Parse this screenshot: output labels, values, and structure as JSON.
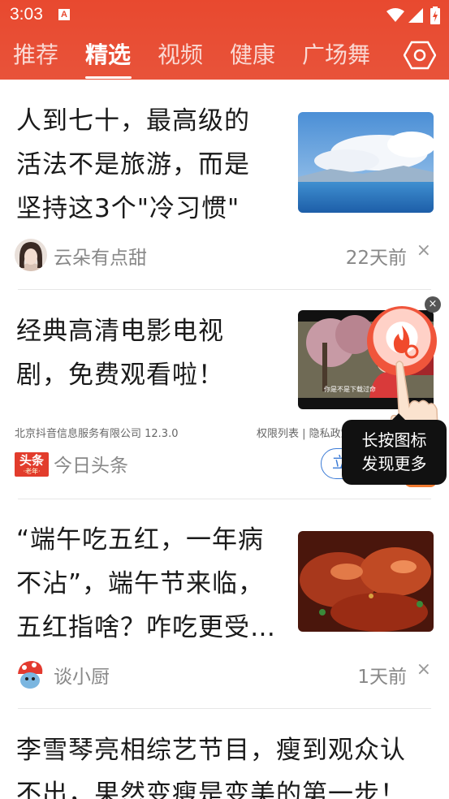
{
  "status_bar": {
    "time": "3:03",
    "notification_letter": "A"
  },
  "tabs": [
    {
      "label": "推荐",
      "active": false
    },
    {
      "label": "精选",
      "active": true
    },
    {
      "label": "视频",
      "active": false
    },
    {
      "label": "健康",
      "active": false
    },
    {
      "label": "广场舞",
      "active": false
    }
  ],
  "feed": [
    {
      "title_lines": [
        "人到七十，最高级的",
        "活法不是旅游，而是",
        "坚持这3个\"冷习惯\""
      ],
      "author": "云朵有点甜",
      "time": "22天前",
      "close": "×"
    },
    {
      "title_lines": [
        "经典高清电影电视",
        "剧，免费观看啦！"
      ],
      "video_caption": "你是不是下载过命",
      "ad": {
        "company": "北京抖音信息服务有限公司  12.3.0",
        "links": "权限列表 | 隐私政策",
        "logo_text": "头条",
        "logo_sub": "·老年·",
        "app_name": "今日头条",
        "button": "立即下载"
      }
    },
    {
      "title_lines": [
        "“端午吃五红，一年病",
        "不沾”，端午节来临，",
        "五红指啥？咋吃更受…"
      ],
      "author": "谈小厨",
      "time": "1天前",
      "close": "×"
    },
    {
      "title_lines": [
        "李雪琴亮相综艺节目，瘦到观众认",
        "不出，果然变瘦是变美的第一步！"
      ]
    }
  ],
  "floating": {
    "close": "×",
    "tooltip_line1": "长按图标",
    "tooltip_line2": "发现更多"
  },
  "colors": {
    "header": "#e8492f",
    "ad_button": "#3b7bd6"
  }
}
